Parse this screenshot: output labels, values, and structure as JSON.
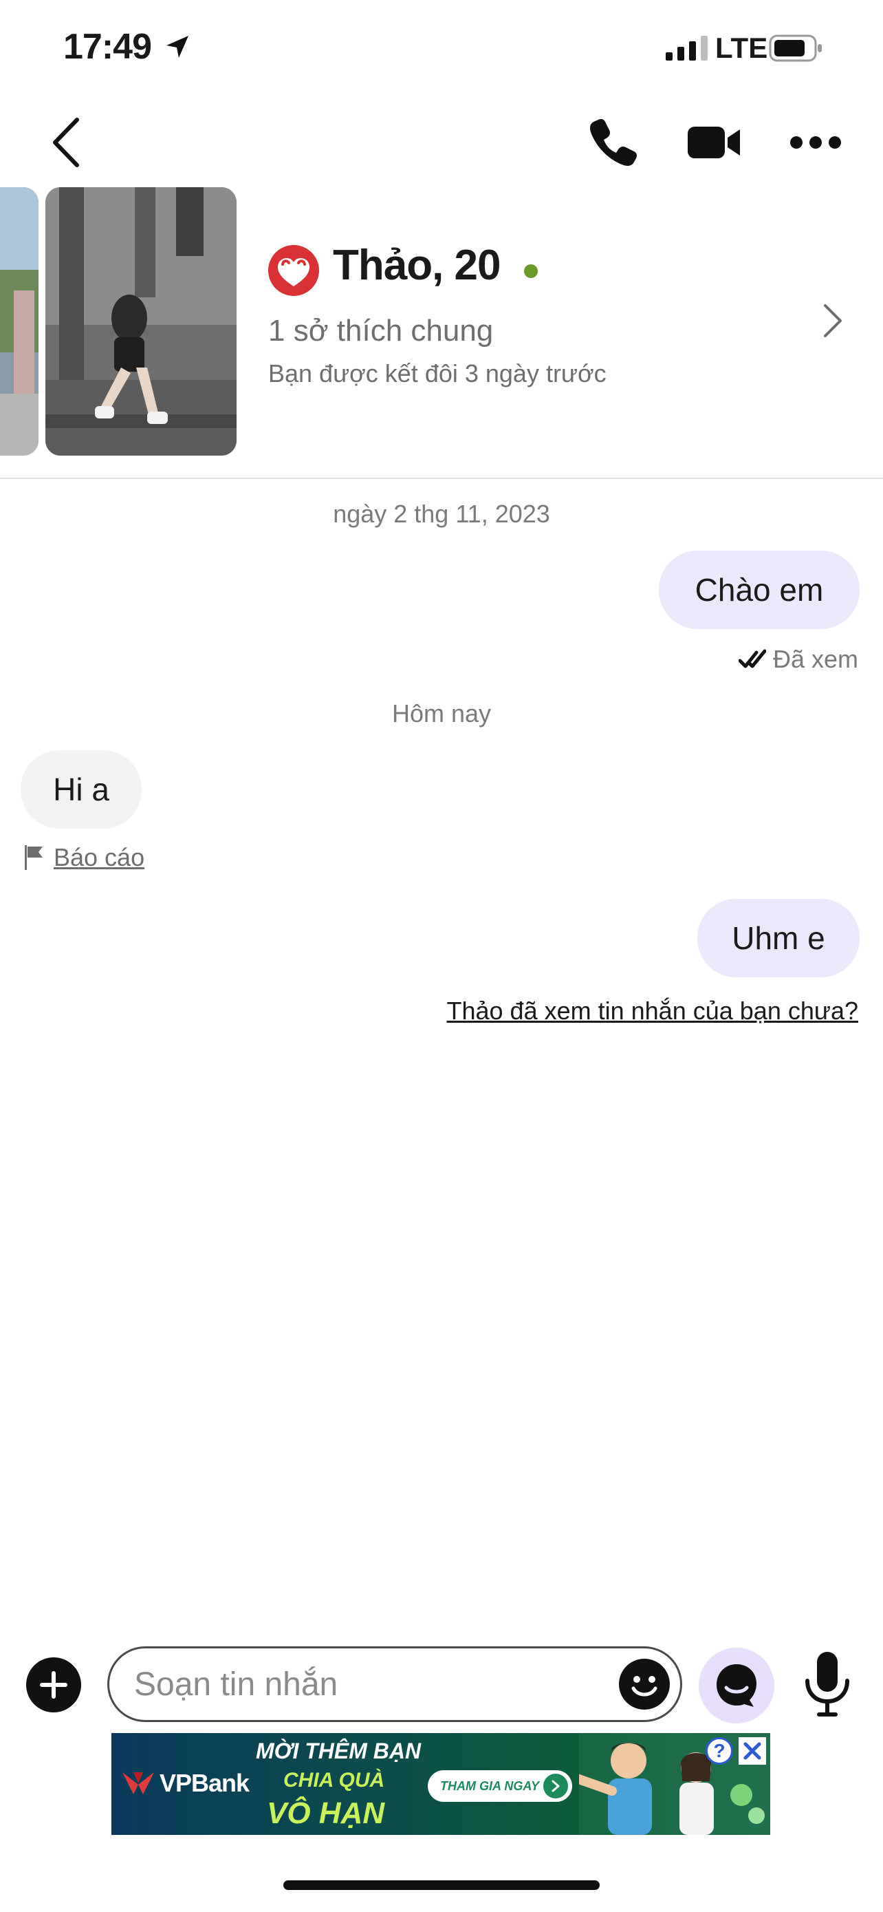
{
  "status_bar": {
    "time": "17:49",
    "network": "LTE",
    "location_icon": "location-arrow-icon",
    "signal_icon": "cell-signal-icon",
    "battery_icon": "battery-icon"
  },
  "header": {
    "back_icon": "chevron-left-icon",
    "call_icon": "phone-icon",
    "video_icon": "video-camera-icon",
    "more_icon": "more-dots-icon"
  },
  "profile": {
    "name_age": "Thảo, 20",
    "online": true,
    "common_interests": "1 sở thích chung",
    "matched_ago": "Bạn được kết đôi 3 ngày trước",
    "logo_icon": "badoo-heart-logo-icon"
  },
  "messages": {
    "date_1": "ngày 2 thg 11, 2023",
    "msg_1": "Chào em",
    "seen_label": "Đã xem",
    "date_2": "Hôm nay",
    "msg_2": "Hi a",
    "report_label": "Báo cáo",
    "msg_3": "Uhm e",
    "seen_question": "Thảo đã xem tin nhắn của bạn chưa?"
  },
  "compose": {
    "placeholder": "Soạn tin nhắn",
    "plus_icon": "plus-circle-icon",
    "emoji_icon": "emoji-smile-icon",
    "sticker_icon": "sticker-face-icon",
    "mic_icon": "microphone-icon"
  },
  "ad": {
    "brand": "VPBank",
    "line1": "MỜI THÊM BẠN",
    "line2": "CHIA QUÀ",
    "line3": "VÔ HẠN",
    "cta": "THAM GIA NGAY",
    "info": "?",
    "colors": {
      "headline": "#ffffff",
      "accent": "#c9f25a",
      "cta": "#1c8a5a"
    }
  },
  "colors": {
    "outgoing_bubble": "#ece8fb",
    "incoming_bubble": "#f2f2f2",
    "online": "#6a9a2a",
    "brand_red": "#d83234"
  }
}
